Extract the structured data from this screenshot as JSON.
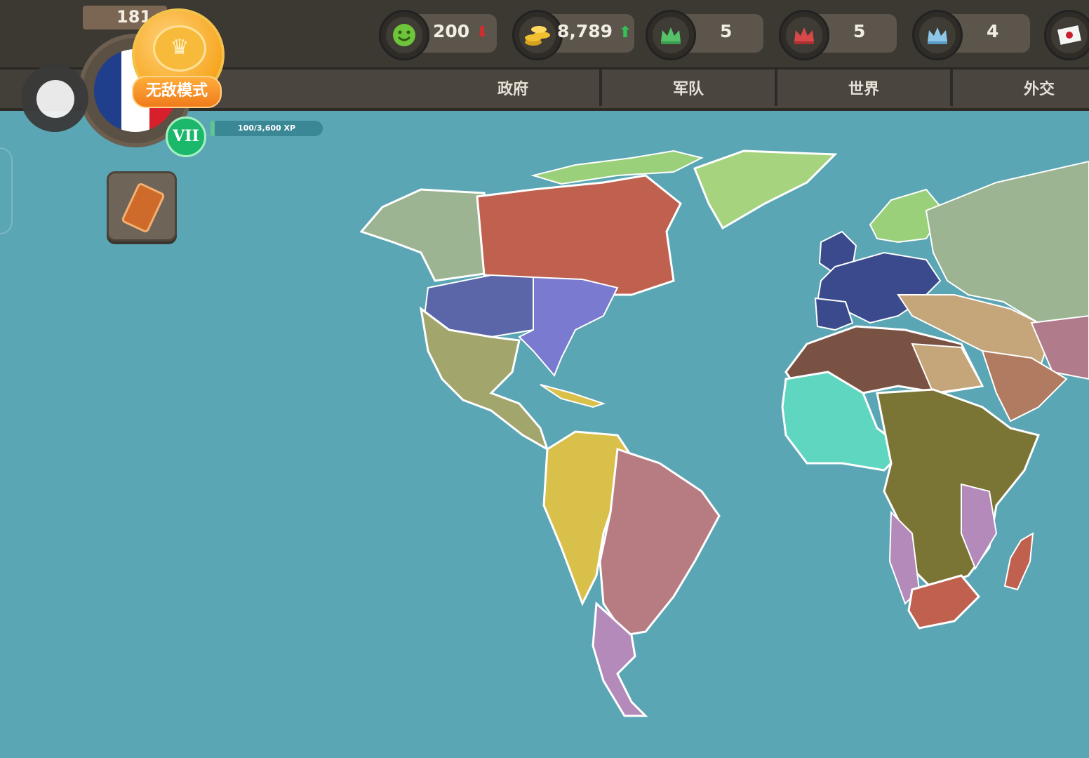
{
  "game": {
    "year": "181",
    "mode_label": "无敌模式",
    "level": "VII",
    "xp_label": "100/3,600 XP",
    "xp_fraction": 0.028,
    "country_flag_colors": [
      "#1f3e8c",
      "#ffffff",
      "#d8202c"
    ]
  },
  "stats": [
    {
      "icon": "happiness-icon",
      "value": "200",
      "trend": "down"
    },
    {
      "icon": "gold-coins-icon",
      "value": "8,789",
      "trend": "up"
    },
    {
      "icon": "green-crown-icon",
      "value": "5",
      "trend": ""
    },
    {
      "icon": "red-crown-icon",
      "value": "5",
      "trend": ""
    },
    {
      "icon": "blue-crown-icon",
      "value": "4",
      "trend": ""
    },
    {
      "icon": "flag-icon",
      "value": "",
      "trend": ""
    }
  ],
  "tabs": [
    "政府",
    "军队",
    "世界",
    "外交"
  ],
  "colors": {
    "ocean": "#5ba6b4",
    "france": "#3b4a8c",
    "britain_canada": "#c0604e",
    "usa": "#7a7ad0",
    "spain_latam": "#d9c04a",
    "portugal_brazil": "#b77b82",
    "russia": "#9cb491"
  }
}
